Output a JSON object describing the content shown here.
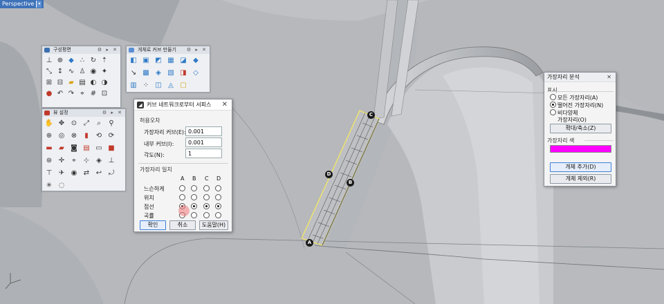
{
  "viewport": {
    "tab_label": "Perspective",
    "tab_arrow": "▾",
    "background": "#b9bbbe",
    "markers": {
      "a": "A",
      "b": "B",
      "c": "C",
      "d": "D"
    }
  },
  "toolbars": {
    "construction_plane": {
      "title": "구성평면",
      "controls": "⚙ ▸ ✕"
    },
    "object_curve": {
      "title": "개체로 커브 만들기",
      "controls": "⚙ ▸ ✕"
    },
    "view_setup": {
      "title": "뷰 설정",
      "controls": "⚙ ▸ ✕"
    }
  },
  "network_dialog": {
    "title": "커브 네트워크로부터 서피스",
    "close": "✕",
    "tolerance_section": "허용오차",
    "edge_curve_label": "가장자리 커브(E):",
    "edge_curve_value": "0.001",
    "inner_curve_label": "내부 커브(I):",
    "inner_curve_value": "0.001",
    "angle_label": "각도(N):",
    "angle_value": "1",
    "edge_match_section": "가장자리 일치",
    "columns": [
      "A",
      "B",
      "C",
      "D"
    ],
    "rows": [
      {
        "label": "느슨하게",
        "selected": [
          false,
          false,
          false,
          false
        ]
      },
      {
        "label": "위치",
        "selected": [
          false,
          false,
          false,
          false
        ]
      },
      {
        "label": "접선",
        "selected": [
          true,
          true,
          true,
          true
        ]
      },
      {
        "label": "곡률",
        "selected": [
          false,
          false,
          false,
          false
        ]
      }
    ],
    "ok": "확인",
    "cancel": "취소",
    "help": "도움말(H)"
  },
  "edge_panel": {
    "title": "가장자리 분석",
    "close": "✕",
    "display_section": "표시",
    "opt_all": "모든 가장자리(A)",
    "opt_naked": "떨어진 가장자리(N)",
    "opt_nonmanifold_1": "비다양체",
    "opt_nonmanifold_2": "가장자리(O)",
    "selected_option": "naked",
    "zoom_button": "확대/축소(Z)",
    "color_section": "가장자리 색",
    "edge_color": "#ff00ff",
    "add_object": "개체 추가(D)",
    "remove_object": "개체 제외(R)"
  }
}
